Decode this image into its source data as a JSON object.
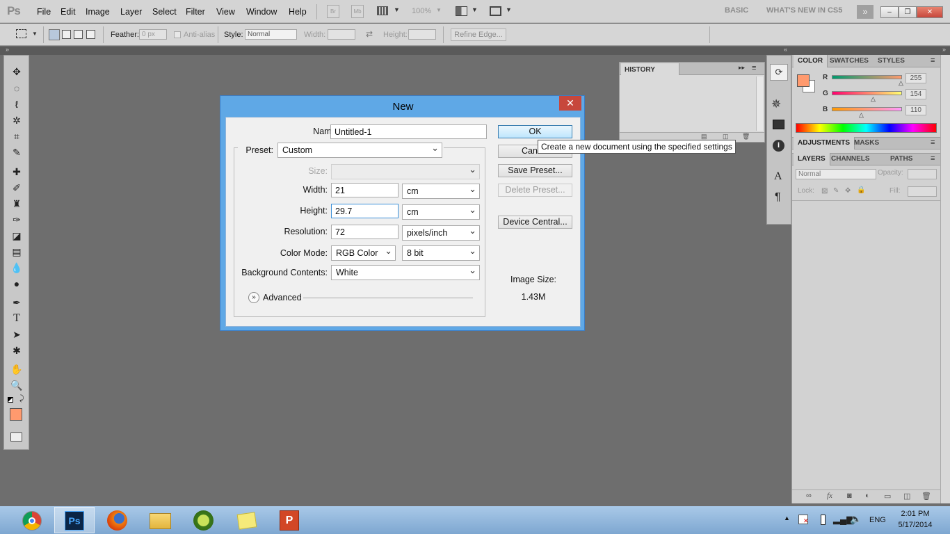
{
  "menubar": {
    "logo": "Ps",
    "items": [
      "File",
      "Edit",
      "Image",
      "Layer",
      "Select",
      "Filter",
      "View",
      "Window",
      "Help"
    ],
    "bridge": "Br",
    "mini_bridge": "Mb",
    "zoom": "100%",
    "workspaces": [
      "BASIC",
      "WHAT'S NEW IN CS5"
    ]
  },
  "options": {
    "feather_label": "Feather:",
    "feather_value": "0 px",
    "antialias_label": "Anti-alias",
    "style_label": "Style:",
    "style_value": "Normal",
    "width_label": "Width:",
    "height_label": "Height:",
    "refine_edge": "Refine Edge..."
  },
  "dialog": {
    "title": "New",
    "name_label": "Name:",
    "name_value": "Untitled-1",
    "preset_label": "Preset:",
    "preset_value": "Custom",
    "size_label": "Size:",
    "width_label": "Width:",
    "width_value": "21",
    "width_unit": "cm",
    "height_label": "Height:",
    "height_value": "29.7",
    "height_unit": "cm",
    "resolution_label": "Resolution:",
    "resolution_value": "72",
    "resolution_unit": "pixels/inch",
    "color_mode_label": "Color Mode:",
    "color_mode_value": "RGB Color",
    "bit_depth": "8 bit",
    "background_label": "Background Contents:",
    "background_value": "White",
    "advanced_label": "Advanced",
    "ok": "OK",
    "cancel": "Cancel",
    "save_preset": "Save Preset...",
    "delete_preset": "Delete Preset...",
    "device_central": "Device Central...",
    "image_size_label": "Image Size:",
    "image_size_value": "1.43M",
    "tooltip": "Create a new document using the specified settings"
  },
  "panels": {
    "history_tab": "HISTORY",
    "color_tabs": [
      "COLOR",
      "SWATCHES",
      "STYLES"
    ],
    "color": {
      "r_label": "R",
      "r_value": "255",
      "g_label": "G",
      "g_value": "154",
      "b_label": "B",
      "b_value": "110",
      "foreground": "#ff9a6e"
    },
    "adjust_tabs": [
      "ADJUSTMENTS",
      "MASKS"
    ],
    "layer_tabs": [
      "LAYERS",
      "CHANNELS",
      "PATHS"
    ],
    "blend_mode": "Normal",
    "opacity_label": "Opacity:",
    "lock_label": "Lock:",
    "fill_label": "Fill:"
  },
  "taskbar": {
    "apps": [
      "chrome-icon",
      "photoshop-icon",
      "firefox-icon",
      "file-explorer-icon",
      "tennis-game-icon",
      "sticky-notes-icon",
      "powerpoint-icon"
    ],
    "ps_label": "Ps",
    "lang": "ENG",
    "time": "2:01 PM",
    "date": "5/17/2014"
  }
}
